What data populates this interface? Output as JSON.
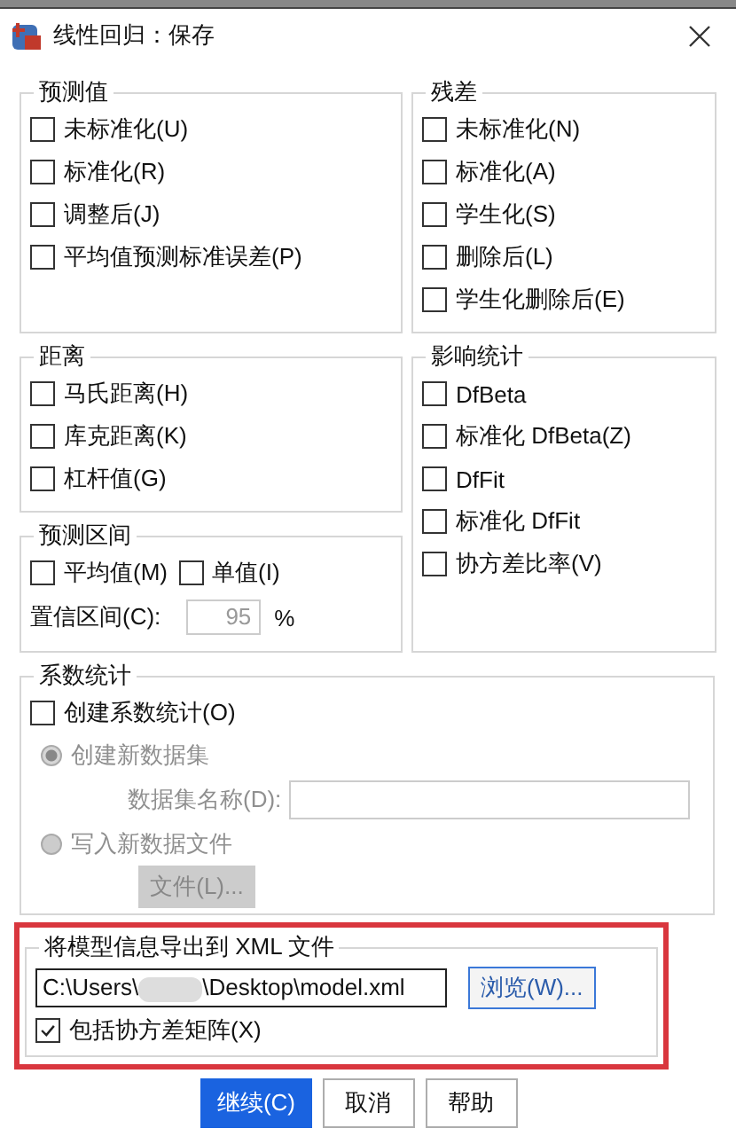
{
  "window": {
    "title": "线性回归：保存"
  },
  "predicted_values": {
    "title": "预测值",
    "options": [
      {
        "label": "未标准化(U)",
        "checked": false
      },
      {
        "label": "标准化(R)",
        "checked": false
      },
      {
        "label": "调整后(J)",
        "checked": false
      },
      {
        "label": "平均值预测标准误差(P)",
        "checked": false
      }
    ]
  },
  "residuals": {
    "title": "残差",
    "options": [
      {
        "label": "未标准化(N)",
        "checked": false
      },
      {
        "label": "标准化(A)",
        "checked": false
      },
      {
        "label": "学生化(S)",
        "checked": false
      },
      {
        "label": "删除后(L)",
        "checked": false
      },
      {
        "label": "学生化删除后(E)",
        "checked": false
      }
    ]
  },
  "distances": {
    "title": "距离",
    "options": [
      {
        "label": "马氏距离(H)",
        "checked": false
      },
      {
        "label": "库克距离(K)",
        "checked": false
      },
      {
        "label": "杠杆值(G)",
        "checked": false
      }
    ]
  },
  "influence_statistics": {
    "title": "影响统计",
    "options": [
      {
        "label": "DfBeta",
        "checked": false
      },
      {
        "label": "标准化 DfBeta(Z)",
        "checked": false
      },
      {
        "label": "DfFit",
        "checked": false
      },
      {
        "label": "标准化 DfFit",
        "checked": false
      },
      {
        "label": "协方差比率(V)",
        "checked": false
      }
    ]
  },
  "prediction_intervals": {
    "title": "预测区间",
    "options": [
      {
        "label": "平均值(M)",
        "checked": false
      },
      {
        "label": "单值(I)",
        "checked": false
      }
    ],
    "confidence_label": "置信区间(C):",
    "confidence_value": "95",
    "confidence_disabled": true,
    "percent": "%"
  },
  "coefficient_statistics": {
    "title": "系数统计",
    "create": {
      "label": "创建系数统计(O)",
      "checked": false
    },
    "disabled": true,
    "radios": [
      {
        "label": "创建新数据集",
        "selected": true
      },
      {
        "label": "写入新数据文件",
        "selected": false
      }
    ],
    "dataset_name_label": "数据集名称(D):",
    "file_button": "文件(L)..."
  },
  "xml_export": {
    "title": "将模型信息导出到 XML 文件",
    "highlighted": true,
    "path_parts": [
      "C:\\Users\\",
      "\\Desktop\\model.xml"
    ],
    "browse_button": "浏览(W)...",
    "include_covariance": {
      "label": "包括协方差矩阵(X)",
      "checked": true
    }
  },
  "buttons": [
    {
      "label": "继续(C)",
      "primary": true
    },
    {
      "label": "取消",
      "primary": false
    },
    {
      "label": "帮助",
      "primary": false
    }
  ]
}
